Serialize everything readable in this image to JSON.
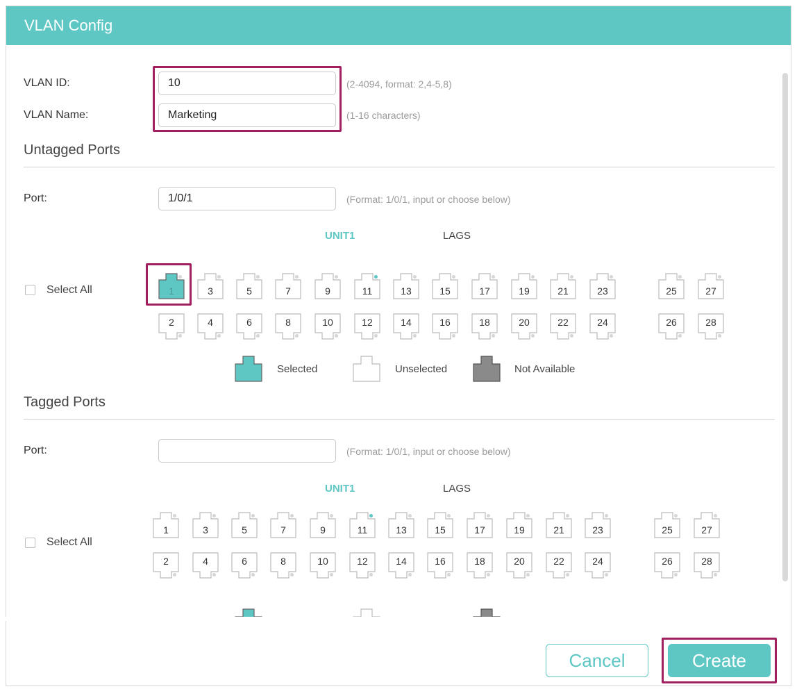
{
  "dialog": {
    "title": "VLAN Config"
  },
  "vlan_id": {
    "label": "VLAN ID:",
    "value": "10",
    "hint": "(2-4094, format: 2,4-5,8)"
  },
  "vlan_name": {
    "label": "VLAN Name:",
    "value": "Marketing",
    "hint": "(1-16 characters)"
  },
  "untagged": {
    "title": "Untagged Ports",
    "port_label": "Port:",
    "port_value": "1/0/1",
    "port_hint": "(Format: 1/0/1, input or choose below)",
    "unit_label": "UNIT1",
    "lags_label": "LAGS",
    "select_all": "Select All",
    "selected_ports": [
      "1"
    ]
  },
  "tagged": {
    "title": "Tagged Ports",
    "port_label": "Port:",
    "port_value": "",
    "port_hint": "(Format: 1/0/1, input or choose below)",
    "unit_label": "UNIT1",
    "lags_label": "LAGS",
    "select_all": "Select All",
    "selected_ports": []
  },
  "ports": {
    "top_row": [
      "1",
      "3",
      "5",
      "7",
      "9",
      "11",
      "13",
      "15",
      "17",
      "19",
      "21",
      "23",
      "25",
      "27"
    ],
    "bottom_row": [
      "2",
      "4",
      "6",
      "8",
      "10",
      "12",
      "14",
      "16",
      "18",
      "20",
      "22",
      "24",
      "26",
      "28"
    ],
    "link_up_port": "11"
  },
  "legend": {
    "selected": "Selected",
    "unselected": "Unselected",
    "not_available": "Not Available"
  },
  "buttons": {
    "cancel": "Cancel",
    "create": "Create"
  },
  "colors": {
    "accent": "#5ec7c4",
    "highlight": "#a21f5f",
    "not_available": "#8a8a8a"
  }
}
